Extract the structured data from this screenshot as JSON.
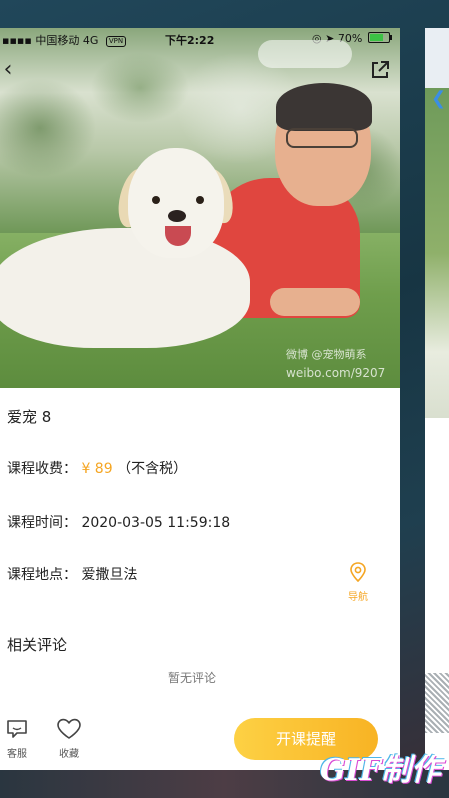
{
  "status_bar": {
    "carrier": "中国移动",
    "network": "4G",
    "vpn": "VPN",
    "time": "下午2:22",
    "battery_text": "70%",
    "battery_level": 0.7
  },
  "hero": {
    "watermark_line1": "微博 @宠物萌系",
    "watermark_line2": "weibo.com/9207"
  },
  "course": {
    "title": "爱宠 8",
    "fee_label": "课程收费：",
    "fee_value": "¥ 89",
    "fee_note": "（不含税）",
    "time_label": "课程时间：",
    "time_value": "2020-03-05 11:59:18",
    "location_label": "课程地点：",
    "location_value": "爱撒旦法",
    "nav_label": "导航"
  },
  "comments": {
    "heading": "相关评论",
    "empty_text": "暂无评论"
  },
  "bottom_bar": {
    "service_label": "客服",
    "favorite_label": "收藏",
    "remind_label": "开课提醒"
  },
  "overlay": {
    "gif_text": "GIF制作"
  },
  "colors": {
    "accent": "#f5a623",
    "button_start": "#fdd144",
    "button_end": "#f8b324"
  }
}
